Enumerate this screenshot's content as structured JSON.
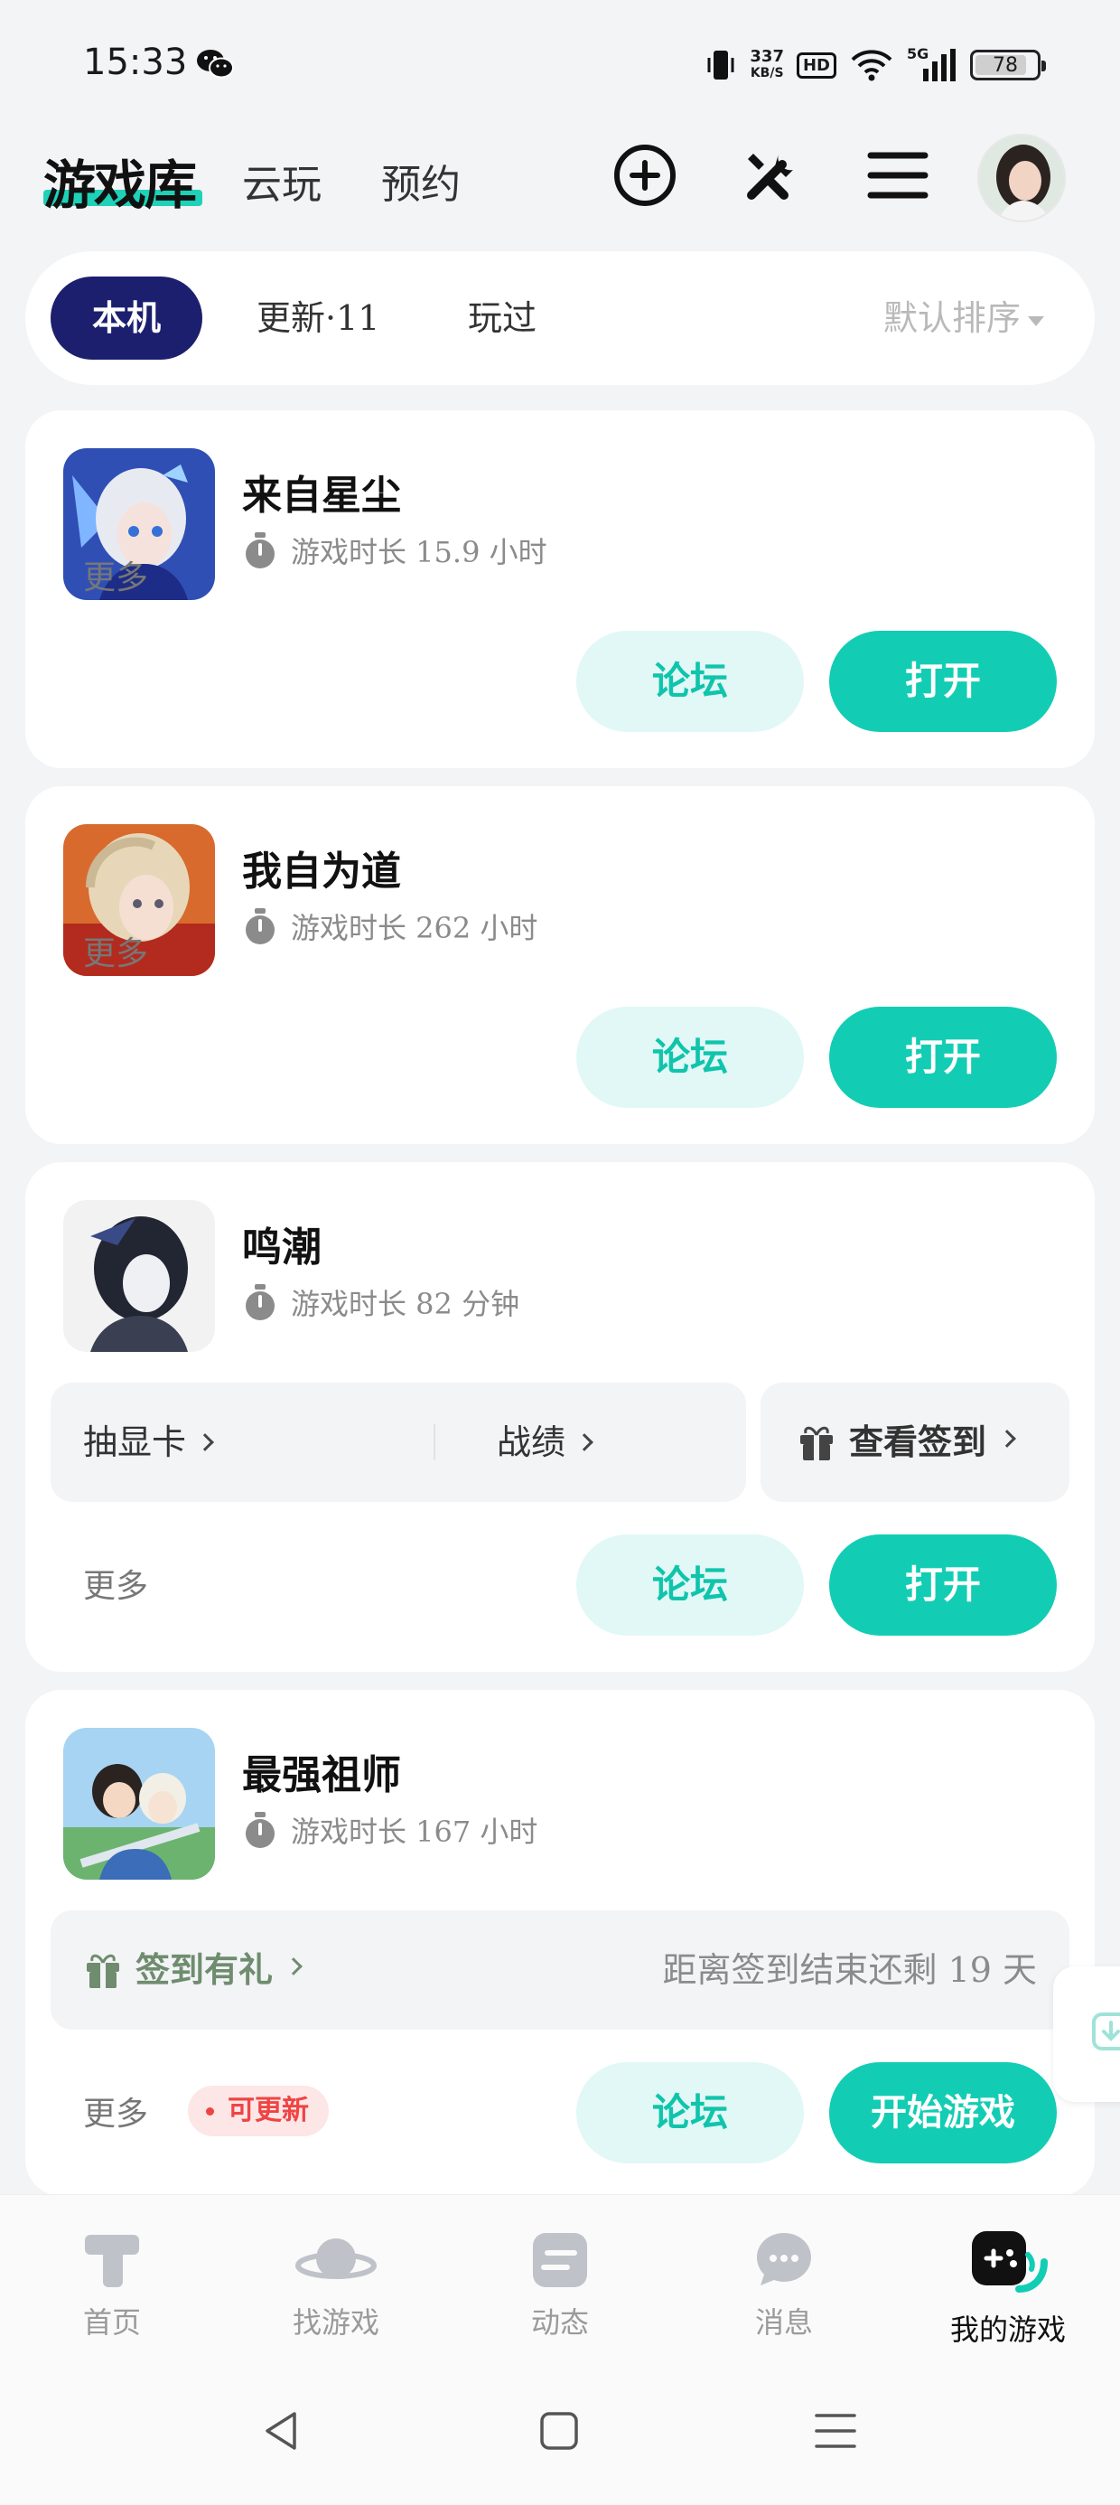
{
  "status_bar": {
    "time": "15:33",
    "net_speed_value": "337",
    "net_speed_unit": "KB/S",
    "hd": "HD",
    "signal": "5G",
    "battery": "78",
    "battery_level": 0.78
  },
  "header": {
    "brand": "游戏库",
    "tabs": [
      "云玩",
      "预约"
    ],
    "icons": [
      "add-circle-icon",
      "tools-icon",
      "menu-icon"
    ]
  },
  "filters": {
    "chips": [
      "本机",
      "更新·11",
      "玩过"
    ],
    "sort_label": "默认排序"
  },
  "common": {
    "more": "更多",
    "forum": "论坛",
    "open": "打开",
    "start": "开始游戏",
    "update_badge": "可更新"
  },
  "games": [
    {
      "name": "来自星尘",
      "playtime": "游戏时长 15.9 小时"
    },
    {
      "name": "我自为道",
      "playtime": "游戏时长 262 小时"
    },
    {
      "name": "鸣潮",
      "playtime": "游戏时长 82 分钟",
      "panel": {
        "left": "抽显卡",
        "middle": "战绩",
        "right": "查看签到"
      }
    },
    {
      "name": "最强祖师",
      "playtime": "游戏时长 167 小时",
      "panel": {
        "left": "签到有礼",
        "right": "距离签到结束还剩 19 天"
      }
    }
  ],
  "bottom_nav": [
    {
      "label": "首页",
      "icon": "home-t-icon"
    },
    {
      "label": "找游戏",
      "icon": "planet-icon"
    },
    {
      "label": "动态",
      "icon": "feed-icon"
    },
    {
      "label": "消息",
      "icon": "chat-icon"
    },
    {
      "label": "我的游戏",
      "icon": "gamepad-icon"
    }
  ],
  "colors": {
    "accent": "#12cdb3",
    "accent_light": "#e1f8f6",
    "chip_active": "#1c1f6e",
    "alert": "#ef4444"
  }
}
